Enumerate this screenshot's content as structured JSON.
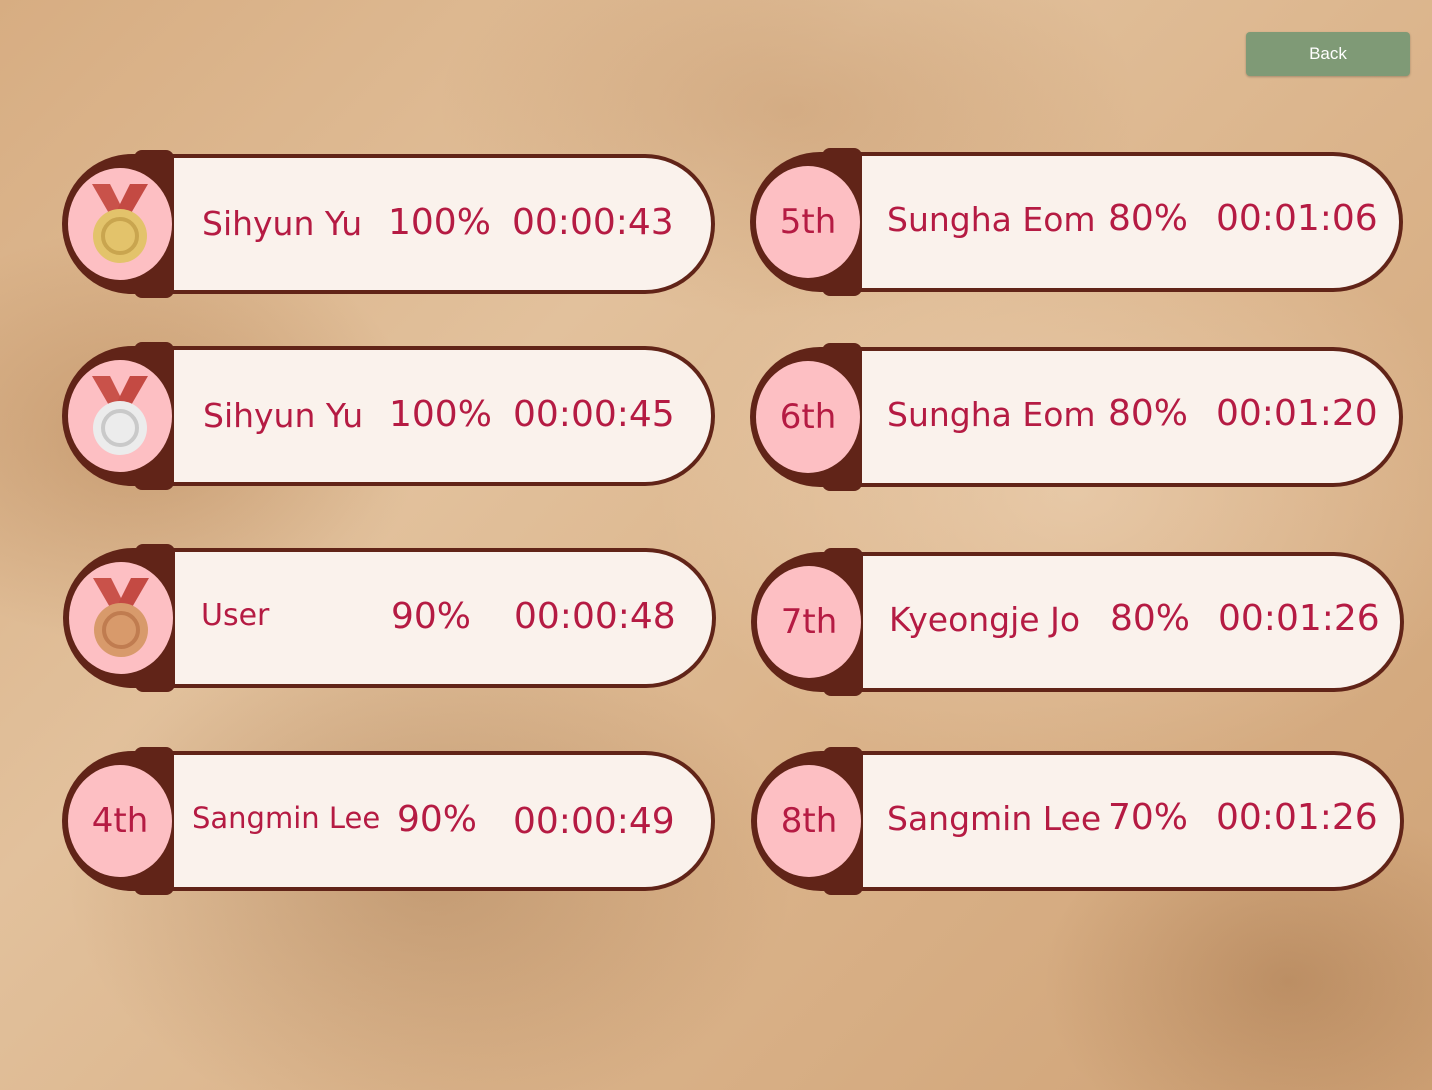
{
  "header": {
    "back_label": "Back"
  },
  "rankings": [
    {
      "rank": "1st",
      "badge": "gold-medal",
      "name": "Sihyun Yu",
      "score": "100%",
      "time": "00:00:43"
    },
    {
      "rank": "2nd",
      "badge": "silver-medal",
      "name": "Sihyun Yu",
      "score": "100%",
      "time": "00:00:45"
    },
    {
      "rank": "3rd",
      "badge": "bronze-medal",
      "name": "User",
      "score": "90%",
      "time": "00:00:48"
    },
    {
      "rank": "4th",
      "badge_label": "4th",
      "name": "Sangmin Lee",
      "score": "90%",
      "time": "00:00:49"
    },
    {
      "rank": "5th",
      "badge_label": "5th",
      "name": "Sungha Eom",
      "score": "80%",
      "time": "00:01:06"
    },
    {
      "rank": "6th",
      "badge_label": "6th",
      "name": "Sungha Eom",
      "score": "80%",
      "time": "00:01:20"
    },
    {
      "rank": "7th",
      "badge_label": "7th",
      "name": "Kyeongje Jo",
      "score": "80%",
      "time": "00:01:26"
    },
    {
      "rank": "8th",
      "badge_label": "8th",
      "name": "Sangmin Lee",
      "score": "70%",
      "time": "00:01:26"
    }
  ],
  "colors": {
    "background": "#d9b48c",
    "card_border": "#612418",
    "card_panel": "#faf2ec",
    "badge_fill": "#fdbfc3",
    "text_accent": "#b51b43",
    "back_button": "#7f9a76",
    "gold": "#e3c36b",
    "silver": "#dcdcdc",
    "bronze": "#d89a6b",
    "ribbon": "#c9524a"
  }
}
